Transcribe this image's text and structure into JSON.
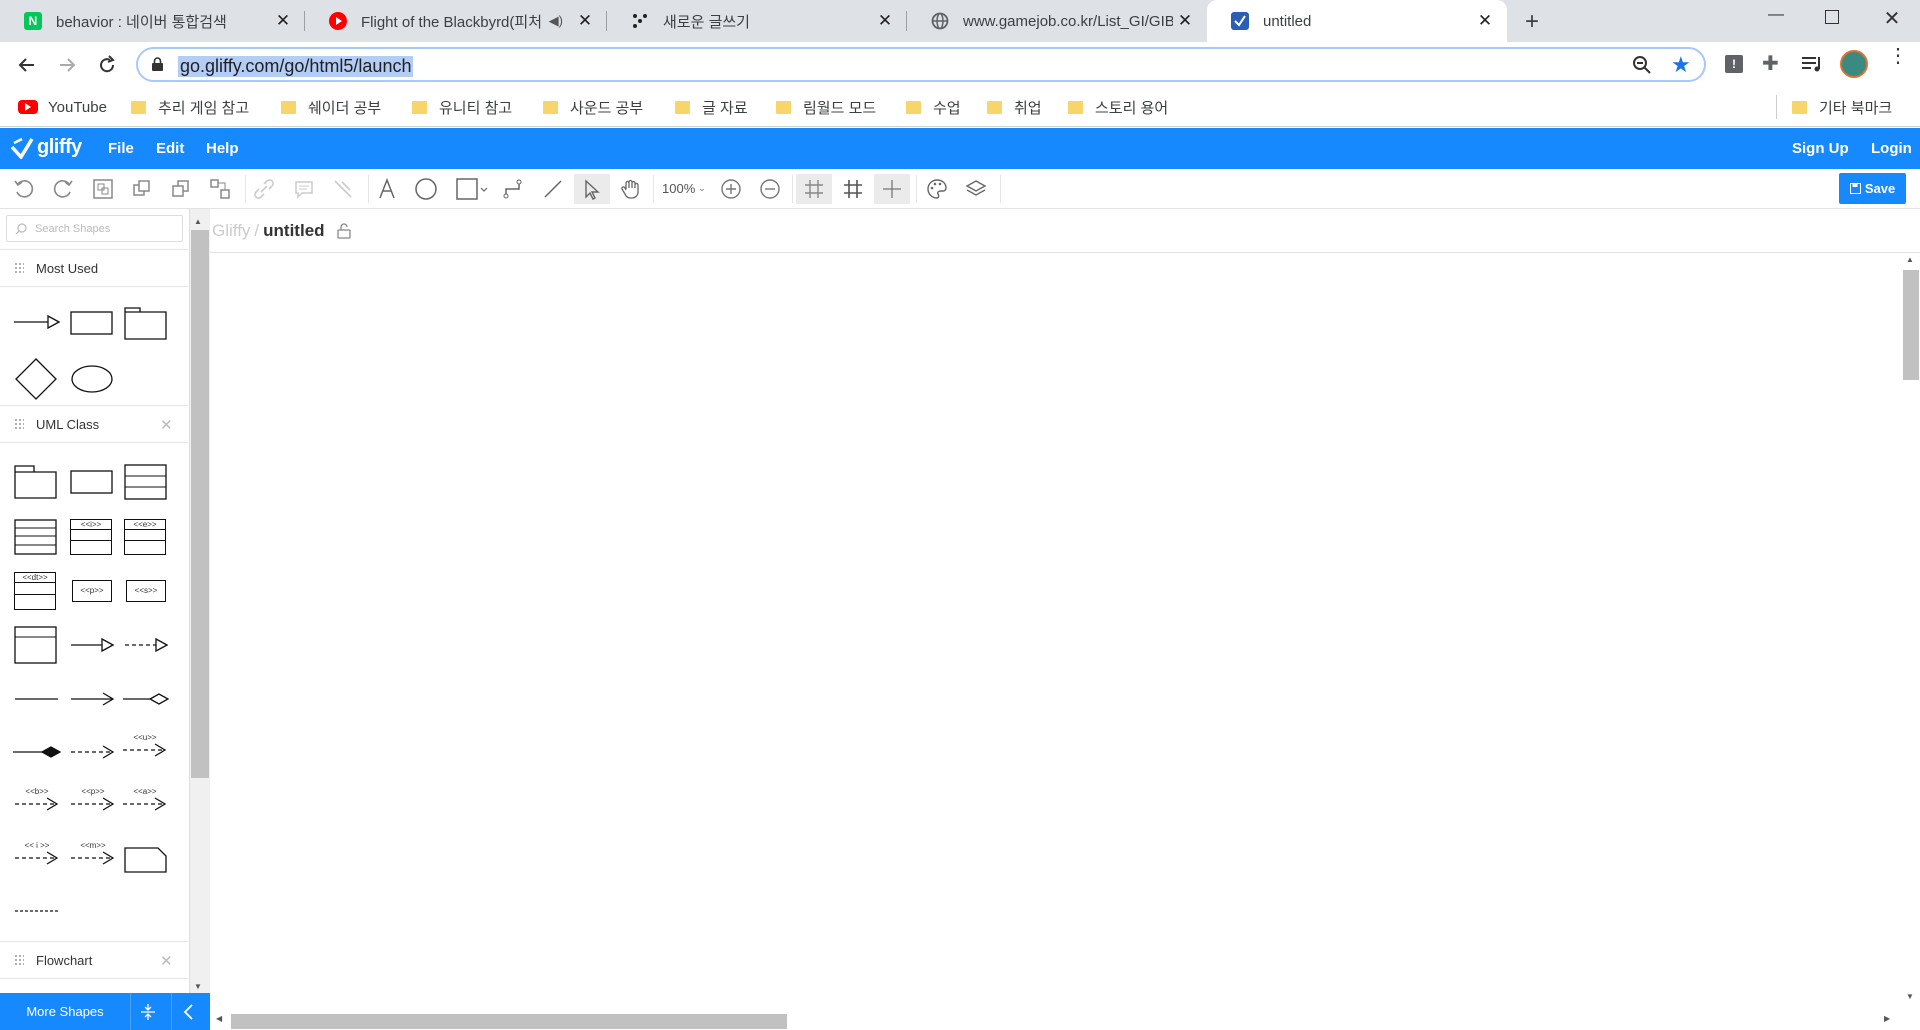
{
  "tabs": [
    {
      "title": "behavior : 네이버 통합검색",
      "icon": "naver-icon",
      "fav_text": "N",
      "color": "#03c75a"
    },
    {
      "title": "Flight of the Blackbyrd(피처",
      "icon": "youtube-music-icon",
      "fav_text": "",
      "color": "#ff0000"
    },
    {
      "title": "새로운 글쓰기",
      "icon": "dots-icon",
      "fav_text": "",
      "color": "#222222"
    },
    {
      "title": "www.gamejob.co.kr/List_GI/GIB_",
      "icon": "globe-icon",
      "fav_text": "",
      "color": "#5f6368"
    },
    {
      "title": "untitled",
      "icon": "gliffy-icon",
      "fav_text": "",
      "color": "#2a5fb3"
    }
  ],
  "address": {
    "url": "go.gliffy.com/go/html5/launch"
  },
  "bookmarks": [
    "YouTube",
    "추리 게임 참고",
    "쉐이더 공부",
    "유니티 참고",
    "사운드 공부",
    "글 자료",
    "림월드 모드",
    "수업",
    "취업",
    "스토리 용어"
  ],
  "other_bookmarks": "기타 북마크",
  "app": {
    "logo": "gliffy",
    "menu": [
      "File",
      "Edit",
      "Help"
    ],
    "signup": "Sign Up",
    "login": "Login",
    "save": "Save",
    "zoom": "100%"
  },
  "sidebar": {
    "search_placeholder": "Search Shapes",
    "sections": [
      "Most Used",
      "UML Class",
      "Flowchart"
    ],
    "stereo": [
      "<<i>>",
      "<<e>>",
      "<<dt>>",
      "<<p>>",
      "<<s>>",
      "<<u>>",
      "<<b>>",
      "<<p>>",
      "<<a>>",
      "<< i >>",
      "<<m>>"
    ],
    "more_shapes": "More Shapes"
  },
  "breadcrumb": {
    "root": "Gliffy",
    "separator": "/",
    "doc": "untitled"
  },
  "colors": {
    "accent": "#1689ff",
    "tabbar": "#dee1e6"
  }
}
